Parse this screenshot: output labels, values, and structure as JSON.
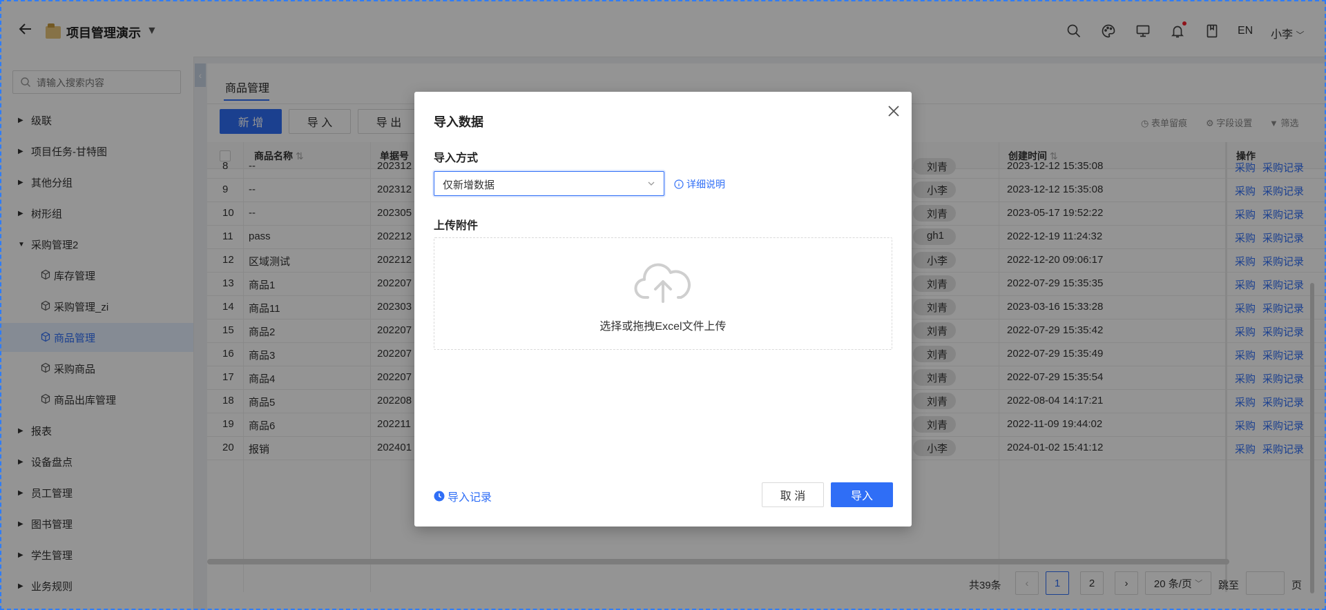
{
  "header": {
    "title": "项目管理演示",
    "lang": "EN",
    "user": "小李"
  },
  "sidebar": {
    "search_placeholder": "请输入搜索内容",
    "items": [
      {
        "label": "级联",
        "level": 0
      },
      {
        "label": "项目任务-甘特图",
        "level": 0
      },
      {
        "label": "其他分组",
        "level": 0
      },
      {
        "label": "树形组",
        "level": 0
      },
      {
        "label": "采购管理2",
        "level": 0,
        "expanded": true
      },
      {
        "label": "库存管理",
        "level": 1
      },
      {
        "label": "采购管理_zi",
        "level": 1
      },
      {
        "label": "商品管理",
        "level": 1,
        "active": true
      },
      {
        "label": "采购商品",
        "level": 1
      },
      {
        "label": "商品出库管理",
        "level": 1
      },
      {
        "label": "报表",
        "level": 0
      },
      {
        "label": "设备盘点",
        "level": 0
      },
      {
        "label": "员工管理",
        "level": 0
      },
      {
        "label": "图书管理",
        "level": 0
      },
      {
        "label": "学生管理",
        "level": 0
      },
      {
        "label": "业务规则",
        "level": 0
      }
    ]
  },
  "main": {
    "tab": "商品管理",
    "toolbar": {
      "add": "新 增",
      "import": "导 入",
      "export": "导 出",
      "form_memo": "表单留痕",
      "field_settings": "字段设置",
      "filter": "筛选"
    },
    "columns": {
      "name": "商品名称",
      "order_no": "单据号",
      "created": "创建时间",
      "ops": "操作"
    },
    "rows": [
      {
        "idx": "8",
        "name": "--",
        "order": "202312",
        "user": "刘青",
        "created": "2023-12-12 15:35:08"
      },
      {
        "idx": "9",
        "name": "--",
        "order": "202312",
        "user": "小李",
        "created": "2023-12-12 15:35:08"
      },
      {
        "idx": "10",
        "name": "--",
        "order": "202305",
        "user": "刘青",
        "created": "2023-05-17 19:52:22"
      },
      {
        "idx": "11",
        "name": "pass",
        "order": "202212",
        "user": "gh1",
        "created": "2022-12-19 11:24:32"
      },
      {
        "idx": "12",
        "name": "区域测试",
        "order": "202212",
        "user": "小李",
        "created": "2022-12-20 09:06:17"
      },
      {
        "idx": "13",
        "name": "商品1",
        "order": "202207",
        "user": "刘青",
        "created": "2022-07-29 15:35:35"
      },
      {
        "idx": "14",
        "name": "商品11",
        "order": "202303",
        "user": "刘青",
        "created": "2023-03-16 15:33:28"
      },
      {
        "idx": "15",
        "name": "商品2",
        "order": "202207",
        "user": "刘青",
        "created": "2022-07-29 15:35:42"
      },
      {
        "idx": "16",
        "name": "商品3",
        "order": "202207",
        "user": "刘青",
        "created": "2022-07-29 15:35:49"
      },
      {
        "idx": "17",
        "name": "商品4",
        "order": "202207",
        "user": "刘青",
        "created": "2022-07-29 15:35:54"
      },
      {
        "idx": "18",
        "name": "商品5",
        "order": "202208",
        "user": "刘青",
        "created": "2022-08-04 14:17:21"
      },
      {
        "idx": "19",
        "name": "商品6",
        "order": "202211",
        "user": "刘青",
        "created": "2022-11-09 19:44:02"
      },
      {
        "idx": "20",
        "name": "报销",
        "order": "202401",
        "user": "小李",
        "created": "2024-01-02 15:41:12"
      }
    ],
    "row_link1": "采购",
    "row_link2": "采购记录",
    "pager": {
      "total": "共39条",
      "page1": "1",
      "page2": "2",
      "page_size": "20 条/页",
      "jump": "跳至",
      "page_unit": "页"
    }
  },
  "modal": {
    "title": "导入数据",
    "import_mode_label": "导入方式",
    "import_mode_value": "仅新增数据",
    "detail_link": "详细说明",
    "upload_label": "上传附件",
    "upload_hint": "选择或拖拽Excel文件上传",
    "import_record": "导入记录",
    "cancel": "取 消",
    "ok": "导入"
  },
  "colors": {
    "primary": "#2f6ef6",
    "mask": "rgba(0,0,0,0.42)"
  }
}
